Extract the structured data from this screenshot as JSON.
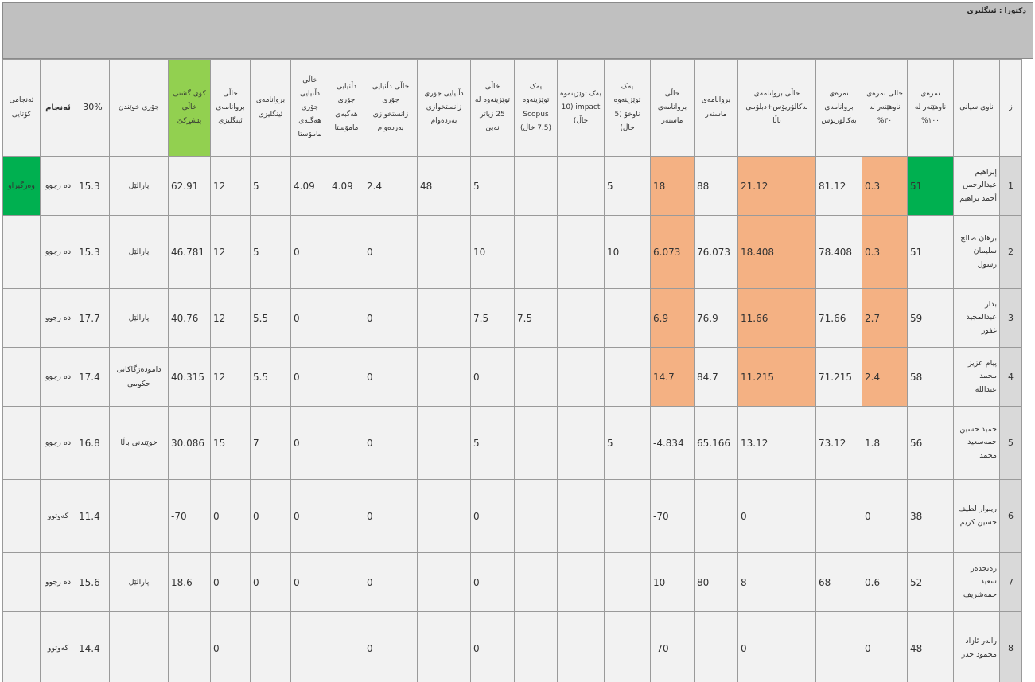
{
  "title": "دكتورا : ئينگليزى",
  "colors": {
    "orange": "#f4b183",
    "green": "#00b050",
    "lime": "#92d050",
    "banner": "#c0c0c0"
  },
  "headers": {
    "index": "ز",
    "name": "ناوى سيانى",
    "score100": "نمرەى ناوهێنەر لە ١٠٠%",
    "points30": "خالی نمرەی ناوهێنەر لە ٣٠%",
    "bachelor_avg": "نمرەى بروانامەى بەکالۆریۆس",
    "bachelor_points": "خاڵی بروانامەی بەکالۆریۆس+دبلۆمی باڵا",
    "master_avg": "بروانامەى ماستەر",
    "master_points": "خاڵی بروانامەی ماستەر",
    "res_local": "یەک توێژینەوە ناوخۆ (5 خاڵ)",
    "res_impact": "یەک توێژینەوە impact (10 خاڵ)",
    "res_scopus": "یەک توێژینەوە Scopus (7.5 خاڵ)",
    "res_25": "خاڵی توێژینەوە لە 25 زیاتر نەبێ",
    "svc_uni": "دڵنیایی جۆری زانستخوازی بەردەوام",
    "svc_uni_points": "خاڵی دڵنیایی جۆری زانستخوازی بەردەوام",
    "svc_teacher": "دڵنیایی جۆری هەگبەی مامۆستا",
    "svc_teacher_points": "خاڵی دڵنیایی جۆری هەگبەی مامۆستا",
    "english_cert": "بروانامەی ئینگلیزی",
    "english_points": "خاڵی بروانامەی ئینگلیزی",
    "total": "کۆی گشتی خاڵی پێشڕکێ",
    "type": "جۆری خوێندن",
    "pct30": "30%",
    "result": "ئەنجام",
    "final": "ئەنجامی کۆتایی"
  },
  "rows": [
    {
      "index": "1",
      "name": "إبراهيم عبدالرحمن أحمد براهيم",
      "score100": "51",
      "points30": "0.3",
      "bachelor_avg": "81.12",
      "bachelor_points": "21.12",
      "master_avg": "88",
      "master_points": "18",
      "res_local": "5",
      "res_impact": "",
      "res_scopus": "",
      "res_25": "5",
      "svc_uni": "48",
      "svc_uni_points": "2.4",
      "svc_teacher": "4.09",
      "svc_teacher_points": "4.09",
      "english_cert": "5",
      "english_points": "12",
      "total": "62.91",
      "type": "پارالێل",
      "pct30": "15.3",
      "result": "دە رجوو",
      "final": "وەرگیراو"
    },
    {
      "index": "2",
      "name": "برهان صالح سليمان رسول",
      "score100": "51",
      "points30": "0.3",
      "bachelor_avg": "78.408",
      "bachelor_points": "18.408",
      "master_avg": "76.073",
      "master_points": "6.073",
      "res_local": "10",
      "res_impact": "",
      "res_scopus": "",
      "res_25": "10",
      "svc_uni": "",
      "svc_uni_points": "0",
      "svc_teacher": "",
      "svc_teacher_points": "0",
      "english_cert": "5",
      "english_points": "12",
      "total": "46.781",
      "type": "پارالێل",
      "pct30": "15.3",
      "result": "دە رجوو",
      "final": ""
    },
    {
      "index": "3",
      "name": "بدار عبدالمجيد غفور",
      "score100": "59",
      "points30": "2.7",
      "bachelor_avg": "71.66",
      "bachelor_points": "11.66",
      "master_avg": "76.9",
      "master_points": "6.9",
      "res_local": "",
      "res_impact": "",
      "res_scopus": "7.5",
      "res_25": "7.5",
      "svc_uni": "",
      "svc_uni_points": "0",
      "svc_teacher": "",
      "svc_teacher_points": "0",
      "english_cert": "5.5",
      "english_points": "12",
      "total": "40.76",
      "type": "پارالێل",
      "pct30": "17.7",
      "result": "دە رجوو",
      "final": ""
    },
    {
      "index": "4",
      "name": "پيام عزيز محمد عبدالله",
      "score100": "58",
      "points30": "2.4",
      "bachelor_avg": "71.215",
      "bachelor_points": "11.215",
      "master_avg": "84.7",
      "master_points": "14.7",
      "res_local": "",
      "res_impact": "",
      "res_scopus": "",
      "res_25": "0",
      "svc_uni": "",
      "svc_uni_points": "0",
      "svc_teacher": "",
      "svc_teacher_points": "0",
      "english_cert": "5.5",
      "english_points": "12",
      "total": "40.315",
      "type": "دامودەزگاکانی حکومی",
      "pct30": "17.4",
      "result": "دە رجوو",
      "final": ""
    },
    {
      "index": "5",
      "name": "حميد حسين حمەسعيد محمد",
      "score100": "56",
      "points30": "1.8",
      "bachelor_avg": "73.12",
      "bachelor_points": "13.12",
      "master_avg": "65.166",
      "master_points": "4.834-",
      "res_local": "5",
      "res_impact": "",
      "res_scopus": "",
      "res_25": "5",
      "svc_uni": "",
      "svc_uni_points": "0",
      "svc_teacher": "",
      "svc_teacher_points": "0",
      "english_cert": "7",
      "english_points": "15",
      "total": "30.086",
      "type": "خوێندنی باڵا",
      "pct30": "16.8",
      "result": "دە رجوو",
      "final": ""
    },
    {
      "index": "6",
      "name": "ريبوار لطيف حسين كريم",
      "score100": "38",
      "points30": "0",
      "bachelor_avg": "",
      "bachelor_points": "0",
      "master_avg": "",
      "master_points": "70-",
      "res_local": "",
      "res_impact": "",
      "res_scopus": "",
      "res_25": "0",
      "svc_uni": "",
      "svc_uni_points": "0",
      "svc_teacher": "",
      "svc_teacher_points": "0",
      "english_cert": "0",
      "english_points": "0",
      "total": "70-",
      "type": "",
      "pct30": "11.4",
      "result": "کەوتوو",
      "final": ""
    },
    {
      "index": "7",
      "name": "رەنجدەر سعيد حمەشريف",
      "score100": "52",
      "points30": "0.6",
      "bachelor_avg": "68",
      "bachelor_points": "8",
      "master_avg": "80",
      "master_points": "10",
      "res_local": "",
      "res_impact": "",
      "res_scopus": "",
      "res_25": "0",
      "svc_uni": "",
      "svc_uni_points": "0",
      "svc_teacher": "",
      "svc_teacher_points": "0",
      "english_cert": "0",
      "english_points": "0",
      "total": "18.6",
      "type": "پارالێل",
      "pct30": "15.6",
      "result": "دە رجوو",
      "final": ""
    },
    {
      "index": "8",
      "name": "رابەر ئازاد محمود خدر",
      "score100": "48",
      "points30": "0",
      "bachelor_avg": "",
      "bachelor_points": "0",
      "master_avg": "",
      "master_points": "70-",
      "res_local": "",
      "res_impact": "",
      "res_scopus": "",
      "res_25": "0",
      "svc_uni": "",
      "svc_uni_points": "0",
      "svc_teacher": "",
      "svc_teacher_points": "",
      "english_cert": "",
      "english_points": "0",
      "total": "",
      "type": "",
      "pct30": "14.4",
      "result": "کەوتوو",
      "final": ""
    }
  ]
}
